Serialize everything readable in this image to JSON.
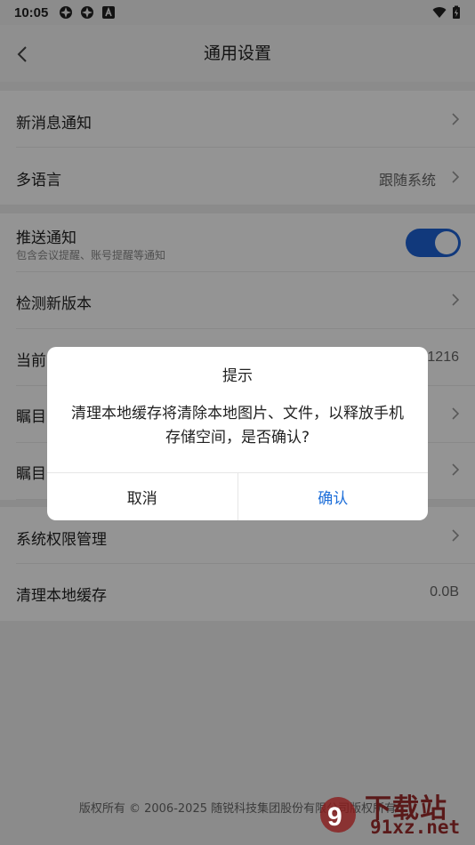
{
  "status_bar": {
    "time": "10:05"
  },
  "header": {
    "title": "通用设置"
  },
  "settings": {
    "new_message": {
      "label": "新消息通知"
    },
    "language": {
      "label": "多语言",
      "value": "跟随系统"
    },
    "push": {
      "label": "推送通知",
      "sub": "包含会议提醒、账号提醒等通知",
      "enabled": true
    },
    "check_update": {
      "label": "检测新版本"
    },
    "current_version": {
      "label": "当前",
      "value": "1216"
    },
    "row_6": {
      "label": "瞩目"
    },
    "row_7": {
      "label": "瞩目"
    },
    "permissions": {
      "label": "系统权限管理"
    },
    "clear_cache": {
      "label": "清理本地缓存",
      "value": "0.0B"
    }
  },
  "dialog": {
    "title": "提示",
    "message": "清理本地缓存将清除本地图片、文件，以释放手机存储空间，是否确认?",
    "cancel": "取消",
    "confirm": "确认"
  },
  "footer": {
    "copyright": "版权所有 © 2006-2025 随锐科技集团股份有限公司版权所有"
  },
  "watermark": {
    "top": "下载站",
    "bottom": "91xz.net"
  },
  "colors": {
    "accent": "#1e63d6",
    "confirm": "#1e6fd9"
  }
}
